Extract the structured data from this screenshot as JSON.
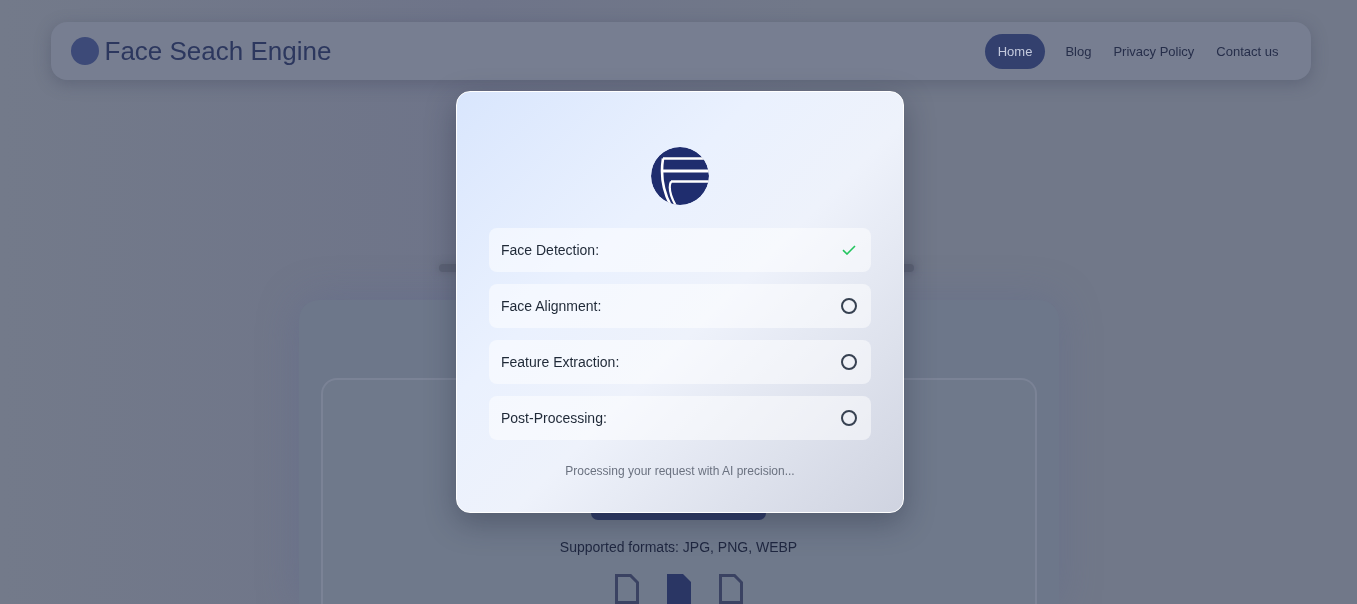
{
  "header": {
    "title": "Face Seach Engine",
    "nav": [
      {
        "label": "Home",
        "selected": true
      },
      {
        "label": "Blog",
        "selected": false
      },
      {
        "label": "Privacy Policy",
        "selected": false
      },
      {
        "label": "Contact us",
        "selected": false
      }
    ]
  },
  "upload": {
    "formats": "Supported formats: JPG, PNG, WEBP"
  },
  "dialog": {
    "steps": [
      {
        "label": "Face Detection:",
        "completed": true
      },
      {
        "label": "Face Alignment:",
        "completed": false
      },
      {
        "label": "Feature Extraction:",
        "completed": false
      },
      {
        "label": "Post-Processing:",
        "completed": false
      }
    ],
    "message": "Processing your request with AI precision..."
  }
}
